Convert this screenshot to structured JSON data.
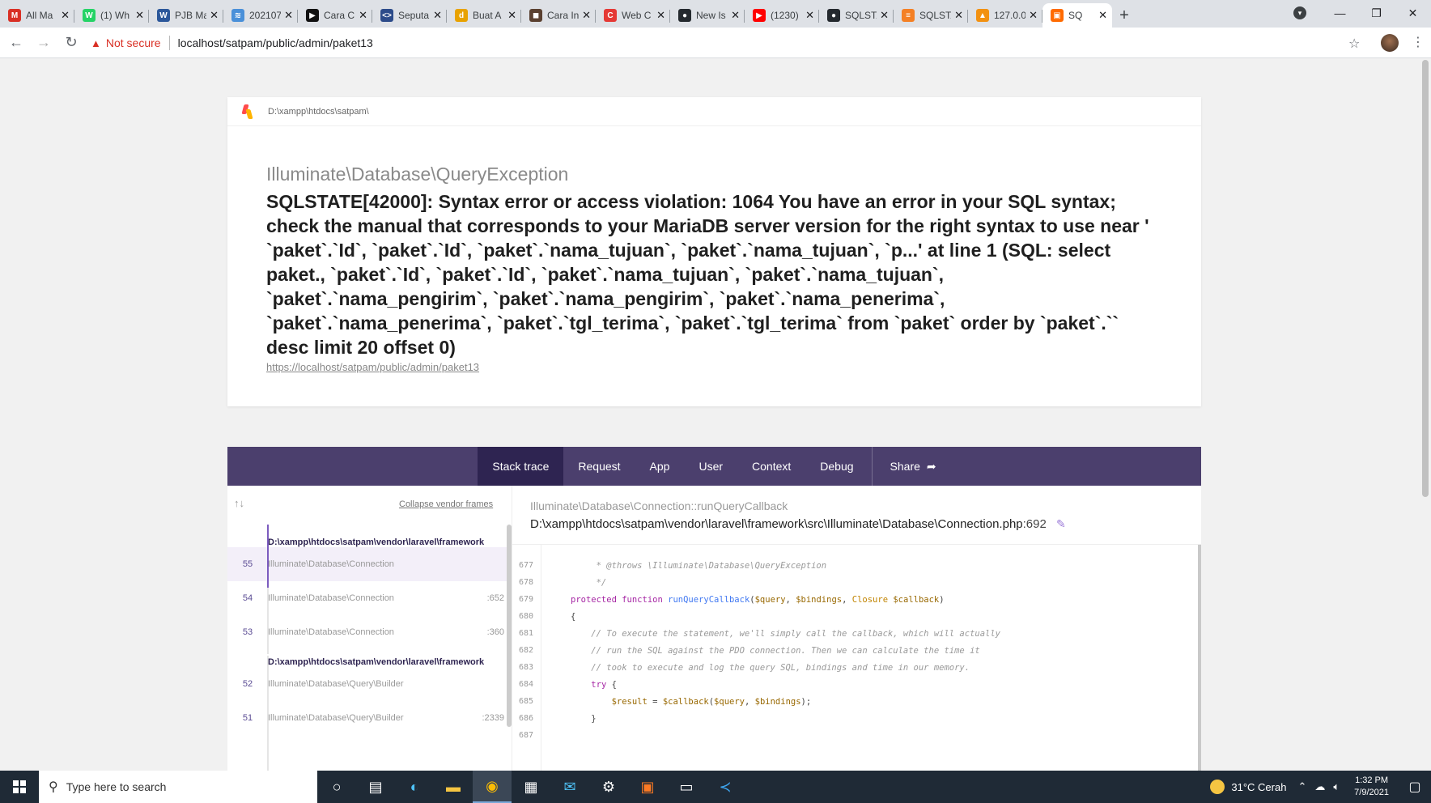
{
  "browser": {
    "tabs": [
      {
        "label": "All Ma",
        "color": "#d93025",
        "glyph": "M"
      },
      {
        "label": "(1) Wh",
        "color": "#25d366",
        "glyph": "W"
      },
      {
        "label": "PJB Ma",
        "color": "#2b579a",
        "glyph": "W"
      },
      {
        "label": "202107",
        "color": "#4a90d9",
        "glyph": "≋"
      },
      {
        "label": "Cara C",
        "color": "#111111",
        "glyph": "▶"
      },
      {
        "label": "Seputa",
        "color": "#2c4b8a",
        "glyph": "<>"
      },
      {
        "label": "Buat A",
        "color": "#e8a200",
        "glyph": "d"
      },
      {
        "label": "Cara In",
        "color": "#5a4030",
        "glyph": "◼"
      },
      {
        "label": "Web C",
        "color": "#e53935",
        "glyph": "C"
      },
      {
        "label": "New Is",
        "color": "#24292e",
        "glyph": "●"
      },
      {
        "label": "(1230)",
        "color": "#ff0000",
        "glyph": "▶"
      },
      {
        "label": "SQLSTA",
        "color": "#24292e",
        "glyph": "●"
      },
      {
        "label": "SQLSTA",
        "color": "#f48024",
        "glyph": "≡"
      },
      {
        "label": "127.0.0",
        "color": "#f29111",
        "glyph": "▲"
      },
      {
        "label": "SQ",
        "color": "#ff6b00",
        "glyph": "▣",
        "active": true
      }
    ],
    "new_tab": "+",
    "address": {
      "not_secure": "Not secure",
      "url": "localhost/satpam/public/admin/paket13"
    }
  },
  "error": {
    "app_path": "D:\\xampp\\htdocs\\satpam\\",
    "exception_class": "Illuminate\\Database\\QueryException",
    "message": "SQLSTATE[42000]: Syntax error or access violation: 1064 You have an error in your SQL syntax; check the manual that corresponds to your MariaDB server version for the right syntax to use near ' `paket`.`Id`, `paket`.`Id`, `paket`.`nama_tujuan`, `paket`.`nama_tujuan`, `p...' at line 1 (SQL: select paket., `paket`.`Id`, `paket`.`Id`, `paket`.`nama_tujuan`, `paket`.`nama_tujuan`, `paket`.`nama_pengirim`, `paket`.`nama_pengirim`, `paket`.`nama_penerima`, `paket`.`nama_penerima`, `paket`.`tgl_terima`, `paket`.`tgl_terima` from `paket` order by `paket`.`` desc limit 20 offset 0)",
    "url": "https://localhost/satpam/public/admin/paket13"
  },
  "panel_tabs": [
    "Stack trace",
    "Request",
    "App",
    "User",
    "Context",
    "Debug"
  ],
  "share_label": "Share",
  "trace": {
    "collapse_label": "Collapse vendor frames",
    "vendor_header": "D:\\xampp\\htdocs\\satpam\\vendor\\laravel\\framework",
    "frames": [
      {
        "num": "55",
        "cls": "Illuminate\\Database\\Connection",
        "line": ""
      },
      {
        "num": "54",
        "cls": "Illuminate\\Database\\Connection",
        "line": ":652"
      },
      {
        "num": "53",
        "cls": "Illuminate\\Database\\Connection",
        "line": ":360"
      },
      {
        "num": "52",
        "cls": "Illuminate\\Database\\Query\\Builder",
        "line": ""
      },
      {
        "num": "51",
        "cls": "Illuminate\\Database\\Query\\Builder",
        "line": ":2339"
      }
    ],
    "function_name": "Illuminate\\Database\\Connection::runQueryCallback",
    "file_path": "D:\\xampp\\htdocs\\satpam\\vendor\\laravel\\framework\\src\\Illuminate\\Database\\Connection.php",
    "file_line": ":692",
    "line_numbers": [
      "677",
      "678",
      "679",
      "680",
      "681",
      "682",
      "683",
      "684",
      "685",
      "686",
      "687"
    ]
  },
  "taskbar": {
    "search_placeholder": "Type here to search",
    "weather": "31°C  Cerah",
    "time": "1:32 PM",
    "date": "7/9/2021"
  }
}
